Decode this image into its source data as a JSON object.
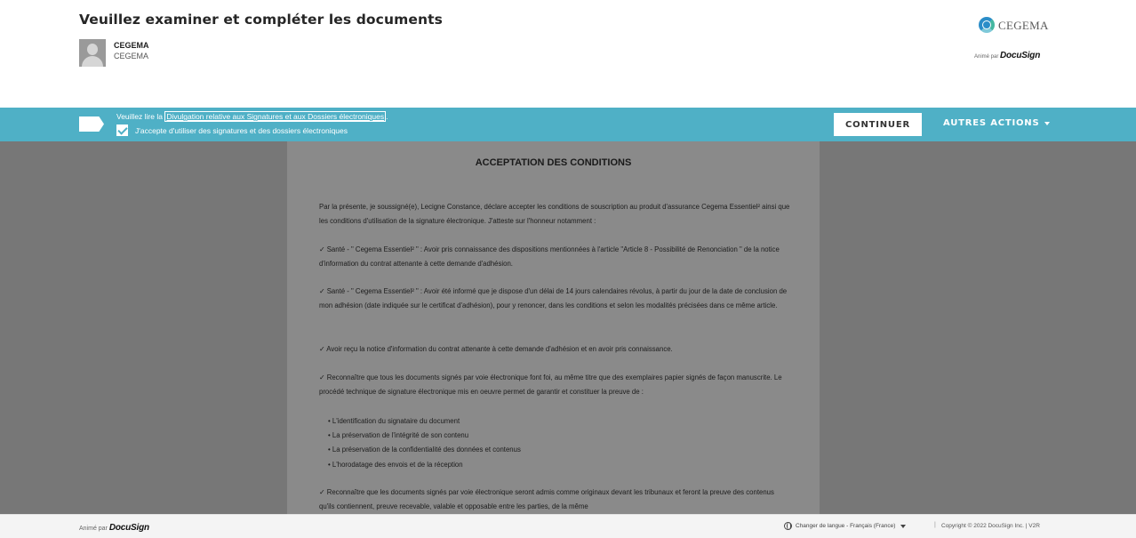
{
  "header": {
    "title": "Veuillez examiner et compléter les documents",
    "sender": {
      "name": "CEGEMA",
      "org": "CEGEMA"
    },
    "brand": {
      "name": "CEGEMA",
      "icon": "cegema-logo-icon"
    },
    "powered_prefix": "Animé par",
    "powered_brand": "DocuSign"
  },
  "action_bar": {
    "read_prefix": "Veuillez lire la",
    "disclosure_link": "Divulgation relative aux Signatures et aux Dossiers électroniques",
    "read_suffix": ".",
    "consent_label": "J'accepte d'utiliser des signatures et des dossiers électroniques",
    "consent_checked": true,
    "continue_label": "CONTINUER",
    "other_actions_label": "AUTRES ACTIONS",
    "colors": {
      "bar": "#4fb0c6"
    }
  },
  "document": {
    "title": "ACCEPTATION DES CONDITIONS",
    "intro": "Par la présente, je soussigné(e), Lecigne Constance, déclare accepter les conditions de souscription au produit d'assurance Cegema Essentiel² ainsi que les conditions d'utilisation de la signature électronique. J'atteste sur l'honneur notamment :",
    "item1": "✓    Santé - \" Cegema Essentiel² \" : Avoir pris connaissance des dispositions mentionnées à l'article \"Article 8 - Possibilité de Renonciation \" de la notice d'information du contrat attenante à cette demande d'adhésion.",
    "item2": "✓    Santé - \" Cegema Essentiel² \" : Avoir été informé que je dispose d'un délai de 14 jours calendaires révolus, à partir du jour de la date de conclusion de mon adhésion (date indiquée sur le certificat d'adhésion), pour y renoncer, dans les conditions et selon les modalités précisées dans ce même article.",
    "item3": "✓    Avoir reçu la notice d'information du contrat attenante à cette demande d'adhésion et en avoir pris connaissance.",
    "item4": "✓    Reconnaître que tous les documents signés par voie électronique font foi, au même titre que des exemplaires papier signés de façon manuscrite. Le procédé technique de signature électronique mis en oeuvre permet de garantir et constituer la preuve de :",
    "bullets": [
      "L'identification du signataire du document",
      "La préservation de l'intégrité de son contenu",
      "La préservation de la confidentialité des données et contenus",
      "L'horodatage des envois et de la réception"
    ],
    "item5": "✓    Reconnaître que les documents signés par voie électronique seront admis comme originaux devant les tribunaux et feront la preuve des contenus qu'ils contiennent, preuve recevable, valable et opposable entre les parties, de la même"
  },
  "footer": {
    "powered_prefix": "Animé par",
    "powered_brand": "DocuSign",
    "language_label": "Changer de langue - Français (France)",
    "separator": "|",
    "copyright": "Copyright © 2022 DocuSign Inc. | V2R"
  }
}
